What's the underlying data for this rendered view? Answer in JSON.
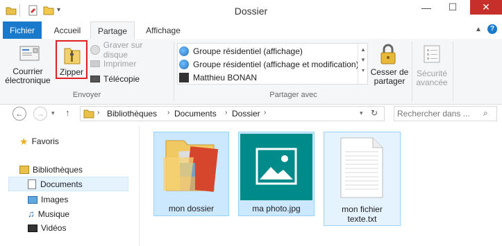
{
  "window": {
    "title": "Dossier",
    "minimize": "—",
    "maximize": "☐",
    "close": "✕"
  },
  "ribbon_tabs": [
    "Fichier",
    "Accueil",
    "Partage",
    "Affichage"
  ],
  "ribbon": {
    "send": {
      "email_label_1": "Courrier",
      "email_label_2": "électronique",
      "zip_label": "Zipper",
      "burn_label": "Graver sur disque",
      "print_label": "Imprimer",
      "fax_label": "Télécopie",
      "group_name": "Envoyer"
    },
    "share_with": {
      "items": [
        "Groupe résidentiel (affichage)",
        "Groupe résidentiel (affichage et modification)",
        "Matthieu BONAN"
      ],
      "stop_sharing_1": "Cesser de",
      "stop_sharing_2": "partager",
      "group_name": "Partager avec"
    },
    "security_1": "Sécurité",
    "security_2": "avancée"
  },
  "address_bar": {
    "segments": [
      "Bibliothèques",
      "Documents",
      "Dossier"
    ],
    "search_placeholder": "Rechercher dans ..."
  },
  "nav_pane": {
    "favorites": "Favoris",
    "libraries": "Bibliothèques",
    "library_items": [
      "Documents",
      "Images",
      "Musique",
      "Vidéos"
    ]
  },
  "files": [
    {
      "name": "mon dossier"
    },
    {
      "name": "ma photo.jpg"
    },
    {
      "name_line1": "mon fichier",
      "name_line2": "texte.txt"
    }
  ],
  "colors": {
    "accent": "#1979ca",
    "selection": "#cce8ff",
    "selection_border": "#99d1ff",
    "close_button": "#c7302a",
    "zip_highlight": "#e02020",
    "photo_tile": "#008b8b"
  }
}
